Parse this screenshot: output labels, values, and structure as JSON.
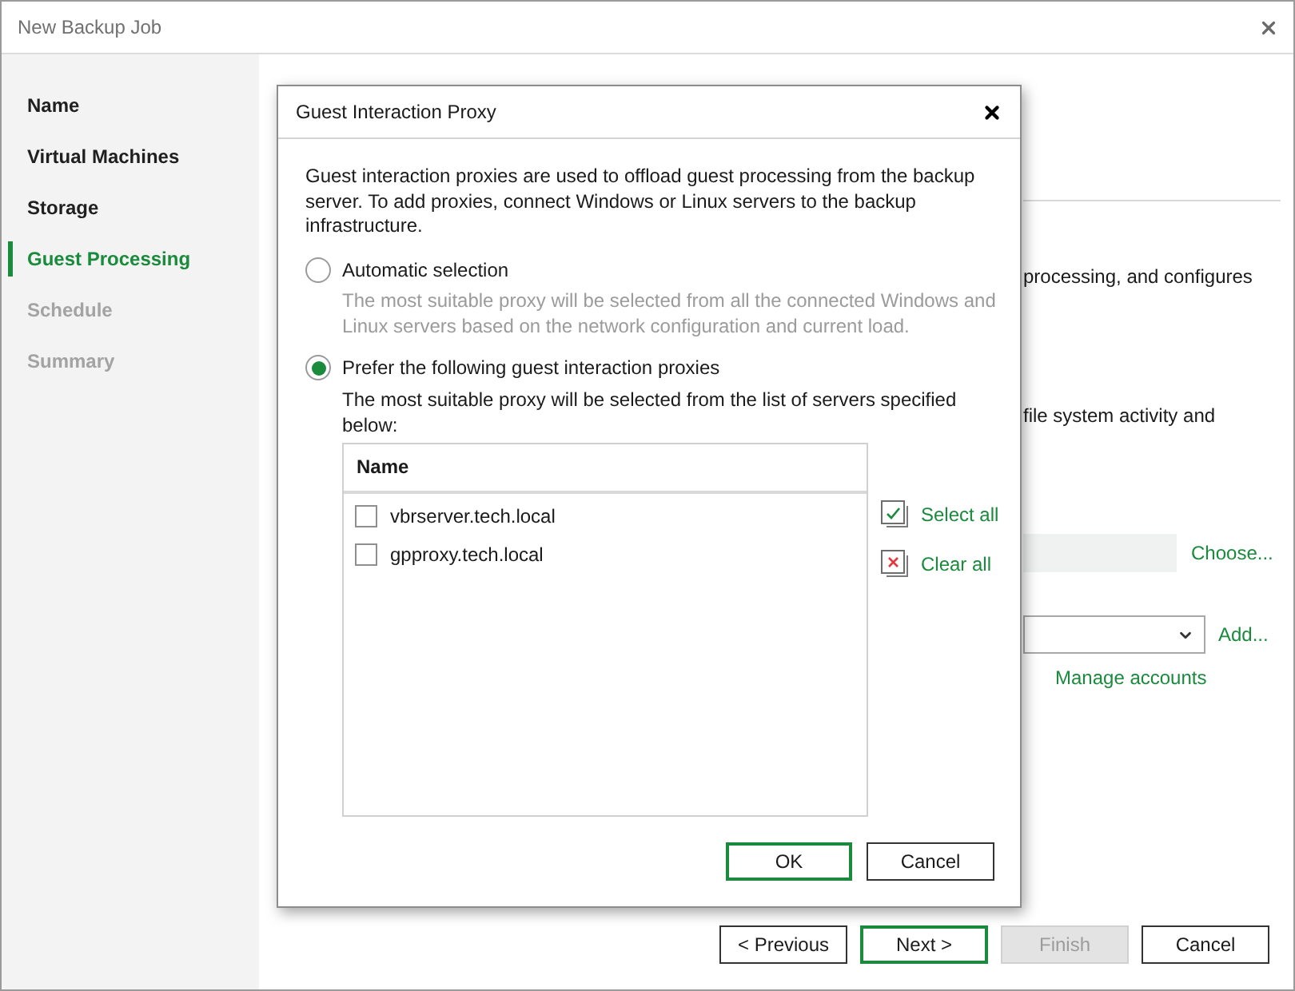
{
  "window": {
    "title": "New Backup Job"
  },
  "sidebar": {
    "items": [
      {
        "label": "Name",
        "selected": false,
        "disabled": false
      },
      {
        "label": "Virtual Machines",
        "selected": false,
        "disabled": false
      },
      {
        "label": "Storage",
        "selected": false,
        "disabled": false
      },
      {
        "label": "Guest Processing",
        "selected": true,
        "disabled": false
      },
      {
        "label": "Schedule",
        "selected": false,
        "disabled": true
      },
      {
        "label": "Summary",
        "selected": false,
        "disabled": true
      }
    ]
  },
  "page": {
    "text_lines": [
      "processing, and configures",
      "file system activity and"
    ],
    "choose_link": "Choose...",
    "add_link": "Add...",
    "manage_link": "Manage accounts"
  },
  "footer_buttons": [
    {
      "label": "< Previous",
      "default": false,
      "disabled": false
    },
    {
      "label": "Next >",
      "default": true,
      "disabled": false
    },
    {
      "label": "Finish",
      "default": false,
      "disabled": true
    },
    {
      "label": "Cancel",
      "default": false,
      "disabled": false
    }
  ],
  "dialog": {
    "title": "Guest Interaction Proxy",
    "intro": "Guest interaction proxies are used to offload guest processing from the backup server. To add proxies, connect Windows or Linux servers to the backup infrastructure.",
    "options": [
      {
        "label": "Automatic selection",
        "selected": false,
        "description": "The most suitable proxy will be selected from all the connected Windows and Linux servers based on the network configuration and current load."
      },
      {
        "label": "Prefer the following guest interaction proxies",
        "selected": true,
        "description": "The most suitable proxy will be selected from the list of servers specified below:"
      }
    ],
    "proxy_table": {
      "columns": [
        "Name"
      ],
      "rows": [
        {
          "name": "vbrserver.tech.local",
          "checked": false
        },
        {
          "name": "gpproxy.tech.local",
          "checked": false
        }
      ]
    },
    "list_actions": [
      {
        "label": "Select all",
        "kind": "select"
      },
      {
        "label": "Clear all",
        "kind": "clear"
      }
    ],
    "buttons": [
      {
        "label": "OK",
        "default": true
      },
      {
        "label": "Cancel",
        "default": false
      }
    ]
  }
}
